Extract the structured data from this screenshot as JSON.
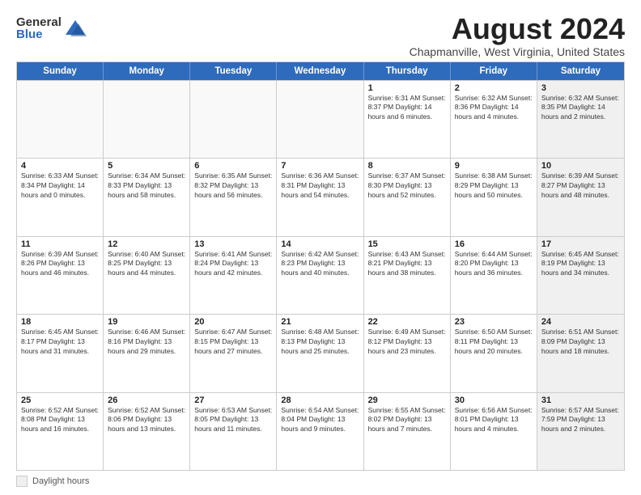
{
  "logo": {
    "general": "General",
    "blue": "Blue"
  },
  "title": "August 2024",
  "subtitle": "Chapmanville, West Virginia, United States",
  "days_of_week": [
    "Sunday",
    "Monday",
    "Tuesday",
    "Wednesday",
    "Thursday",
    "Friday",
    "Saturday"
  ],
  "footer": {
    "daylight_label": "Daylight hours"
  },
  "weeks": [
    [
      {
        "day": "",
        "info": "",
        "empty": true
      },
      {
        "day": "",
        "info": "",
        "empty": true
      },
      {
        "day": "",
        "info": "",
        "empty": true
      },
      {
        "day": "",
        "info": "",
        "empty": true
      },
      {
        "day": "1",
        "info": "Sunrise: 6:31 AM\nSunset: 8:37 PM\nDaylight: 14 hours\nand 6 minutes.",
        "empty": false
      },
      {
        "day": "2",
        "info": "Sunrise: 6:32 AM\nSunset: 8:36 PM\nDaylight: 14 hours\nand 4 minutes.",
        "empty": false
      },
      {
        "day": "3",
        "info": "Sunrise: 6:32 AM\nSunset: 8:35 PM\nDaylight: 14 hours\nand 2 minutes.",
        "empty": false,
        "shaded": true
      }
    ],
    [
      {
        "day": "4",
        "info": "Sunrise: 6:33 AM\nSunset: 8:34 PM\nDaylight: 14 hours\nand 0 minutes.",
        "empty": false
      },
      {
        "day": "5",
        "info": "Sunrise: 6:34 AM\nSunset: 8:33 PM\nDaylight: 13 hours\nand 58 minutes.",
        "empty": false
      },
      {
        "day": "6",
        "info": "Sunrise: 6:35 AM\nSunset: 8:32 PM\nDaylight: 13 hours\nand 56 minutes.",
        "empty": false
      },
      {
        "day": "7",
        "info": "Sunrise: 6:36 AM\nSunset: 8:31 PM\nDaylight: 13 hours\nand 54 minutes.",
        "empty": false
      },
      {
        "day": "8",
        "info": "Sunrise: 6:37 AM\nSunset: 8:30 PM\nDaylight: 13 hours\nand 52 minutes.",
        "empty": false
      },
      {
        "day": "9",
        "info": "Sunrise: 6:38 AM\nSunset: 8:29 PM\nDaylight: 13 hours\nand 50 minutes.",
        "empty": false
      },
      {
        "day": "10",
        "info": "Sunrise: 6:39 AM\nSunset: 8:27 PM\nDaylight: 13 hours\nand 48 minutes.",
        "empty": false,
        "shaded": true
      }
    ],
    [
      {
        "day": "11",
        "info": "Sunrise: 6:39 AM\nSunset: 8:26 PM\nDaylight: 13 hours\nand 46 minutes.",
        "empty": false
      },
      {
        "day": "12",
        "info": "Sunrise: 6:40 AM\nSunset: 8:25 PM\nDaylight: 13 hours\nand 44 minutes.",
        "empty": false
      },
      {
        "day": "13",
        "info": "Sunrise: 6:41 AM\nSunset: 8:24 PM\nDaylight: 13 hours\nand 42 minutes.",
        "empty": false
      },
      {
        "day": "14",
        "info": "Sunrise: 6:42 AM\nSunset: 8:23 PM\nDaylight: 13 hours\nand 40 minutes.",
        "empty": false
      },
      {
        "day": "15",
        "info": "Sunrise: 6:43 AM\nSunset: 8:21 PM\nDaylight: 13 hours\nand 38 minutes.",
        "empty": false
      },
      {
        "day": "16",
        "info": "Sunrise: 6:44 AM\nSunset: 8:20 PM\nDaylight: 13 hours\nand 36 minutes.",
        "empty": false
      },
      {
        "day": "17",
        "info": "Sunrise: 6:45 AM\nSunset: 8:19 PM\nDaylight: 13 hours\nand 34 minutes.",
        "empty": false,
        "shaded": true
      }
    ],
    [
      {
        "day": "18",
        "info": "Sunrise: 6:45 AM\nSunset: 8:17 PM\nDaylight: 13 hours\nand 31 minutes.",
        "empty": false
      },
      {
        "day": "19",
        "info": "Sunrise: 6:46 AM\nSunset: 8:16 PM\nDaylight: 13 hours\nand 29 minutes.",
        "empty": false
      },
      {
        "day": "20",
        "info": "Sunrise: 6:47 AM\nSunset: 8:15 PM\nDaylight: 13 hours\nand 27 minutes.",
        "empty": false
      },
      {
        "day": "21",
        "info": "Sunrise: 6:48 AM\nSunset: 8:13 PM\nDaylight: 13 hours\nand 25 minutes.",
        "empty": false
      },
      {
        "day": "22",
        "info": "Sunrise: 6:49 AM\nSunset: 8:12 PM\nDaylight: 13 hours\nand 23 minutes.",
        "empty": false
      },
      {
        "day": "23",
        "info": "Sunrise: 6:50 AM\nSunset: 8:11 PM\nDaylight: 13 hours\nand 20 minutes.",
        "empty": false
      },
      {
        "day": "24",
        "info": "Sunrise: 6:51 AM\nSunset: 8:09 PM\nDaylight: 13 hours\nand 18 minutes.",
        "empty": false,
        "shaded": true
      }
    ],
    [
      {
        "day": "25",
        "info": "Sunrise: 6:52 AM\nSunset: 8:08 PM\nDaylight: 13 hours\nand 16 minutes.",
        "empty": false
      },
      {
        "day": "26",
        "info": "Sunrise: 6:52 AM\nSunset: 8:06 PM\nDaylight: 13 hours\nand 13 minutes.",
        "empty": false
      },
      {
        "day": "27",
        "info": "Sunrise: 6:53 AM\nSunset: 8:05 PM\nDaylight: 13 hours\nand 11 minutes.",
        "empty": false
      },
      {
        "day": "28",
        "info": "Sunrise: 6:54 AM\nSunset: 8:04 PM\nDaylight: 13 hours\nand 9 minutes.",
        "empty": false
      },
      {
        "day": "29",
        "info": "Sunrise: 6:55 AM\nSunset: 8:02 PM\nDaylight: 13 hours\nand 7 minutes.",
        "empty": false
      },
      {
        "day": "30",
        "info": "Sunrise: 6:56 AM\nSunset: 8:01 PM\nDaylight: 13 hours\nand 4 minutes.",
        "empty": false
      },
      {
        "day": "31",
        "info": "Sunrise: 6:57 AM\nSunset: 7:59 PM\nDaylight: 13 hours\nand 2 minutes.",
        "empty": false,
        "shaded": true
      }
    ]
  ]
}
